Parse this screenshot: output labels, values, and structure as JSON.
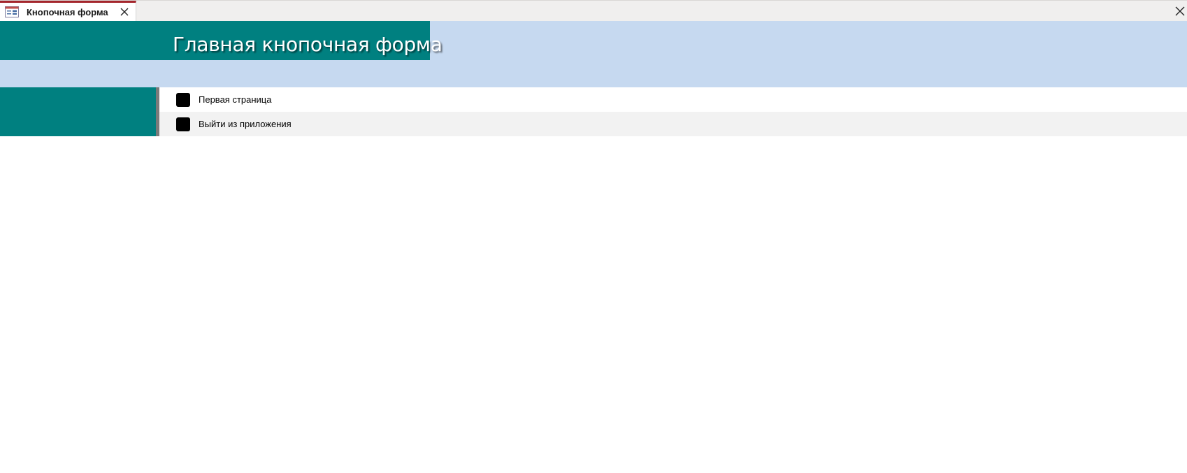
{
  "tab": {
    "title": "Кнопочная форма",
    "icon": "form-icon",
    "close_icon": "close-icon"
  },
  "window": {
    "close_icon": "close-icon"
  },
  "form": {
    "title": "Главная кнопочная форма",
    "colors": {
      "teal": "#008080",
      "header_blue": "#c6d9f0",
      "tab_accent": "#a4262c"
    }
  },
  "menu": {
    "items": [
      {
        "label": "Первая страница"
      },
      {
        "label": "Выйти из приложения"
      }
    ]
  }
}
